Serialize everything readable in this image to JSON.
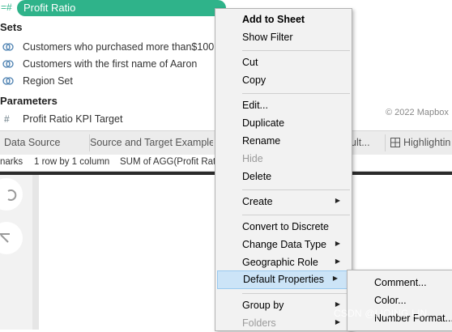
{
  "data_pane": {
    "selected_field": "Profit Ratio",
    "sets_header": "Sets",
    "sets": [
      "Customers who purchased more than$100",
      "Customers with the first name of Aaron",
      "Region Set"
    ],
    "parameters_header": "Parameters",
    "parameters": [
      "Profit Ratio KPI Target"
    ]
  },
  "map": {
    "credit": "© 2022 Mapbox"
  },
  "tabs": {
    "data_source": "Data Source",
    "sheet1": "Source and Target Example",
    "sheet2": "ult...",
    "sheet3": "Highlightin"
  },
  "status_bar": {
    "marks": "narks",
    "rows_cols": "1 row by 1 column",
    "sum": "SUM of AGG(Profit Rat"
  },
  "context_menu": {
    "items": [
      {
        "label": "Add to Sheet",
        "bold": true
      },
      {
        "label": "Show Filter"
      },
      {
        "label": "Cut"
      },
      {
        "label": "Copy"
      },
      {
        "label": "Edit..."
      },
      {
        "label": "Duplicate"
      },
      {
        "label": "Rename"
      },
      {
        "label": "Hide",
        "disabled": true
      },
      {
        "label": "Delete"
      },
      {
        "label": "Create"
      },
      {
        "label": "Convert to Discrete"
      },
      {
        "label": "Change Data Type"
      },
      {
        "label": "Geographic Role"
      },
      {
        "label": "Default Properties"
      },
      {
        "label": "Group by"
      },
      {
        "label": "Folders",
        "disabled": true
      }
    ]
  },
  "submenu": {
    "items": [
      "Comment...",
      "Color...",
      "Number Format..."
    ]
  },
  "watermark": "CSDN @LIQING LIN",
  "colors": {
    "pill": "#2fb38a",
    "menu_bg": "#f2f2f2",
    "menu_highlight": "#cce4f7"
  },
  "icons": [
    "hash-icon",
    "set-icon",
    "submenu-arrow-icon",
    "chart-icon"
  ]
}
